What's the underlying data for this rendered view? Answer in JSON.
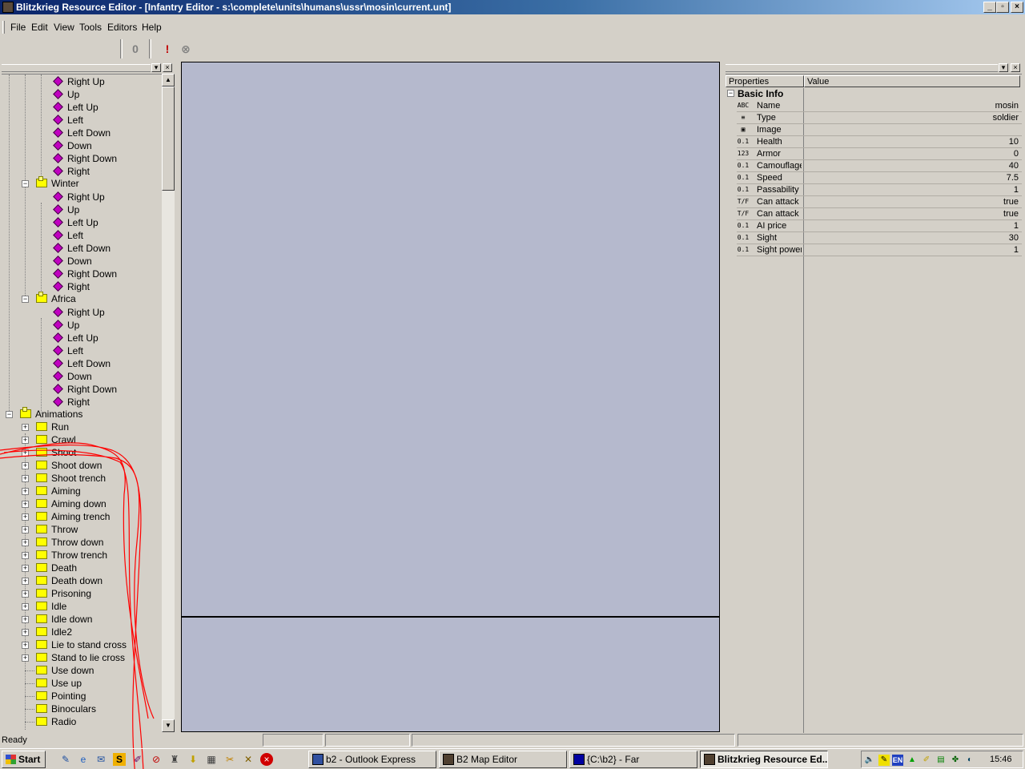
{
  "window": {
    "title": "Blitzkrieg Resource Editor - [Infantry Editor - s:\\complete\\units\\humans\\ussr\\mosin\\current.unt]"
  },
  "menu": [
    {
      "label": "File"
    },
    {
      "label": "Edit"
    },
    {
      "label": "View"
    },
    {
      "label": "Tools"
    },
    {
      "label": "Editors"
    },
    {
      "label": "Help"
    }
  ],
  "toolbar": {
    "buttons": [
      {
        "icon": "stop-icon",
        "glyph": "0"
      },
      {
        "icon": "exclamation-icon",
        "glyph": "!"
      },
      {
        "icon": "cancel-icon",
        "glyph": "⊗"
      }
    ]
  },
  "tree": {
    "group1_directions": [
      "Right Up",
      "Up",
      "Left Up",
      "Left",
      "Left Down",
      "Down",
      "Right Down",
      "Right"
    ],
    "winter": {
      "label": "Winter",
      "items": [
        "Right Up",
        "Up",
        "Left Up",
        "Left",
        "Left Down",
        "Down",
        "Right Down",
        "Right"
      ]
    },
    "africa": {
      "label": "Africa",
      "items": [
        "Right Up",
        "Up",
        "Left Up",
        "Left",
        "Left Down",
        "Down",
        "Right Down",
        "Right"
      ]
    },
    "animations": {
      "label": "Animations",
      "items": [
        "Run",
        "Crawl",
        "Shoot",
        "Shoot down",
        "Shoot trench",
        "Aiming",
        "Aiming down",
        "Aiming trench",
        "Throw",
        "Throw down",
        "Throw trench",
        "Death",
        "Death down",
        "Prisoning",
        "Idle",
        "Idle down",
        "Idle2",
        "Lie to stand cross",
        "Stand to lie cross",
        "Use down",
        "Use up",
        "Pointing",
        "Binoculars",
        "Radio"
      ],
      "expandable_count": 19
    }
  },
  "properties": {
    "header_name": "Properties",
    "header_value": "Value",
    "group": "Basic Info",
    "rows": [
      {
        "icon": "ABC",
        "name": "Name",
        "value": "mosin"
      },
      {
        "icon": "≡",
        "name": "Type",
        "value": "soldier"
      },
      {
        "icon": "▣",
        "name": "Image",
        "value": ""
      },
      {
        "icon": "0.1",
        "name": "Health",
        "value": "10"
      },
      {
        "icon": "123",
        "name": "Armor",
        "value": "0"
      },
      {
        "icon": "0.1",
        "name": "Camouflage",
        "value": "40"
      },
      {
        "icon": "0.1",
        "name": "Speed",
        "value": "7.5"
      },
      {
        "icon": "0.1",
        "name": "Passability",
        "value": "1"
      },
      {
        "icon": "T/F",
        "name": "Can attack u",
        "value": "true"
      },
      {
        "icon": "T/F",
        "name": "Can attack c",
        "value": "true"
      },
      {
        "icon": "0.1",
        "name": "AI price",
        "value": "1"
      },
      {
        "icon": "0.1",
        "name": "Sight",
        "value": "30"
      },
      {
        "icon": "0.1",
        "name": "Sight power",
        "value": "1"
      }
    ]
  },
  "status": {
    "text": "Ready"
  },
  "taskbar": {
    "start_label": "Start",
    "tasks": [
      {
        "label": "b2 - Outlook Express",
        "active": false
      },
      {
        "label": "B2 Map Editor",
        "active": false
      },
      {
        "label": "{C:\\b2} - Far",
        "active": false
      },
      {
        "label": "Blitzkrieg Resource Ed...",
        "active": true
      }
    ],
    "tray_lang": "EN",
    "clock": "15:46"
  }
}
